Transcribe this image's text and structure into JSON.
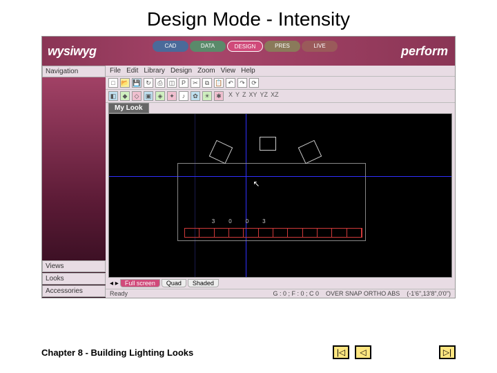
{
  "slide": {
    "title": "Design Mode - Intensity",
    "chapter": "Chapter 8 - Building Lighting Looks"
  },
  "app": {
    "logo_left": "wysiwyg",
    "logo_right": "perform",
    "modes": {
      "cad": "CAD",
      "data": "DATA",
      "design": "DESIGN",
      "pres": "PRES",
      "live": "LIVE"
    },
    "menu": [
      "File",
      "Edit",
      "Library",
      "Design",
      "Zoom",
      "View",
      "Help"
    ],
    "view_tab": "My Look",
    "sidebar": {
      "top": "Navigation",
      "views": "Views",
      "looks": "Looks",
      "accessories": "Accessories"
    },
    "bottom_tabs": {
      "fullscreen": "Full screen",
      "quad": "Quad",
      "shaded": "Shaded"
    },
    "status": {
      "left": "Ready",
      "coords1": "G : 0 ; F : 0 ; C  0",
      "flags": "OVER  SNAP  ORTHO  ABS",
      "coords2": "(-1'6\",13'8\",0'0\")"
    },
    "axis": {
      "x": "X",
      "y": "Y",
      "z": "Z",
      "xy": "XY",
      "yz": "YZ",
      "xz": "XZ"
    },
    "truss_labels": [
      "3",
      "0",
      "0",
      "3"
    ]
  },
  "nav": {
    "prev": "◁",
    "rewind": "|◁",
    "next": "▷|"
  }
}
